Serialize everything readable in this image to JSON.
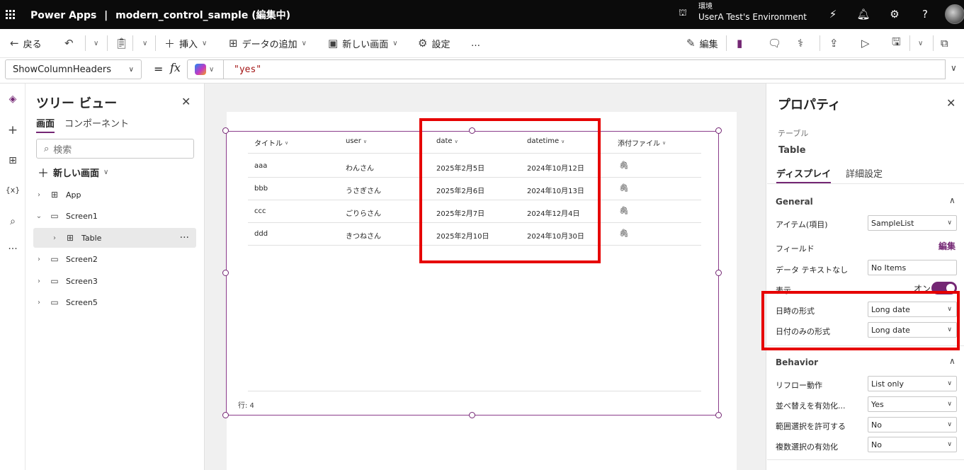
{
  "topbar": {
    "app_name": "Power Apps",
    "separator": "|",
    "document_title": "modern_control_sample (編集中)",
    "environment_label": "環境",
    "environment_name": "UserA Test's Environment"
  },
  "commandbar": {
    "back": "戻る",
    "insert": "挿入",
    "add_data": "データの追加",
    "new_screen": "新しい画面",
    "settings": "設定",
    "more": "…",
    "edit": "編集"
  },
  "formulabar": {
    "property": "ShowColumnHeaders",
    "equals": "=",
    "fx": "fx",
    "formula": "\"yes\""
  },
  "tree": {
    "title": "ツリー ビュー",
    "tabs": [
      "画面",
      "コンポーネント"
    ],
    "search_placeholder": "検索",
    "new_screen": "新しい画面",
    "items": [
      {
        "label": "App"
      },
      {
        "label": "Screen1"
      },
      {
        "label": "Table"
      },
      {
        "label": "Screen2"
      },
      {
        "label": "Screen3"
      },
      {
        "label": "Screen5"
      }
    ]
  },
  "table": {
    "columns": [
      "タイトル",
      "user",
      "date",
      "datetime",
      "添付ファイル"
    ],
    "rows": [
      [
        "aaa",
        "わんさん",
        "2025年2月5日",
        "2024年10月12日"
      ],
      [
        "bbb",
        "うさぎさん",
        "2025年2月6日",
        "2024年10月13日"
      ],
      [
        "ccc",
        "ごりらさん",
        "2025年2月7日",
        "2024年12月4日"
      ],
      [
        "ddd",
        "きつねさん",
        "2025年2月10日",
        "2024年10月30日"
      ]
    ],
    "row_count": "行: 4"
  },
  "properties": {
    "title": "プロパティ",
    "control_type": "テーブル",
    "control_name": "Table",
    "tabs": [
      "ディスプレイ",
      "詳細設定"
    ],
    "general": {
      "heading": "General",
      "items_label": "アイテム(項目)",
      "items_value": "SampleList",
      "fields_label": "フィールド",
      "fields_link": "編集",
      "no_data_label": "データ テキストなし",
      "no_data_value": "No Items",
      "visible_label": "表示",
      "visible_value": "オン",
      "datetime_format_label": "日時の形式",
      "datetime_format_value": "Long date",
      "date_format_label": "日付のみの形式",
      "date_format_value": "Long date"
    },
    "behavior": {
      "heading": "Behavior",
      "reflow_label": "リフロー動作",
      "reflow_value": "List only",
      "sort_label": "並べ替えを有効化...",
      "sort_value": "Yes",
      "range_label": "範囲選択を許可する",
      "range_value": "No",
      "multi_label": "複数選択の有効化",
      "multi_value": "No"
    }
  },
  "colors": {
    "accent": "#742774",
    "highlight": "#e60000",
    "topbar": "#0b0b0b"
  }
}
